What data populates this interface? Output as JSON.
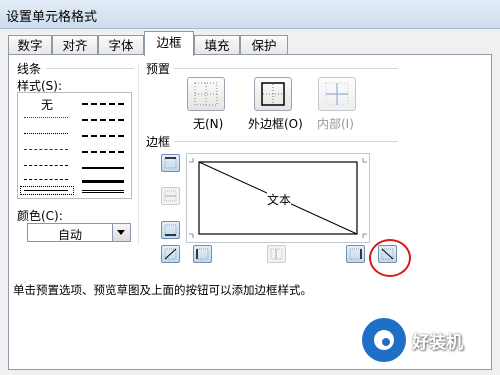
{
  "window": {
    "title": "设置单元格格式"
  },
  "tabs": [
    {
      "label": "数字"
    },
    {
      "label": "对齐"
    },
    {
      "label": "字体"
    },
    {
      "label": "边框"
    },
    {
      "label": "填充"
    },
    {
      "label": "保护"
    }
  ],
  "active_tab": "边框",
  "line": {
    "group_label": "线条",
    "style_label": "样式(S):",
    "none_label": "无",
    "color_label": "颜色(C):",
    "color_value": "自动"
  },
  "presets": {
    "group_label": "预置",
    "none_label": "无(N)",
    "outline_label": "外边框(O)",
    "inside_label": "内部(I)"
  },
  "border": {
    "group_label": "边框",
    "preview_text": "文本"
  },
  "hint": "单击预置选项、预览草图及上面的按钮可以添加边框样式。",
  "watermark": {
    "text": "好装机"
  },
  "colors": {
    "highlight_circle": "#d41a1a",
    "button_blue": "#6f8fb3",
    "logo_blue": "#1f6fc6"
  }
}
